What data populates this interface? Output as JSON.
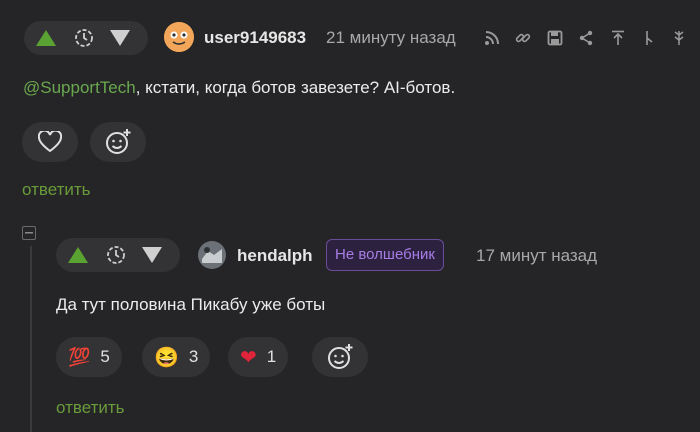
{
  "comment1": {
    "username": "user9149683",
    "time": "21 минуту назад",
    "mention": "@SupportTech",
    "text_rest": ", кстати, когда ботов завезете? AI-ботов.",
    "reply_label": "ответить",
    "icons": [
      "arrow-up-icon",
      "clock-icon",
      "arrow-down-icon",
      "rss-icon",
      "link-icon",
      "save-icon",
      "share-icon",
      "scroll-up-icon",
      "branch-icon",
      "more-icon"
    ]
  },
  "comment2": {
    "username": "hendalph",
    "badge": "Не волшебник",
    "time": "17 минут назад",
    "text": "Да тут половина Пикабу уже боты",
    "reply_label": "ответить",
    "reactions": [
      {
        "emoji": "💯",
        "count": "5"
      },
      {
        "emoji": "😆",
        "count": "3"
      },
      {
        "emoji": "❤",
        "count": "1"
      }
    ]
  },
  "colors": {
    "background": "#252527",
    "accent_green": "#6aa84f",
    "vote_up": "#4a8a2a",
    "badge_purple": "#a87de6"
  }
}
